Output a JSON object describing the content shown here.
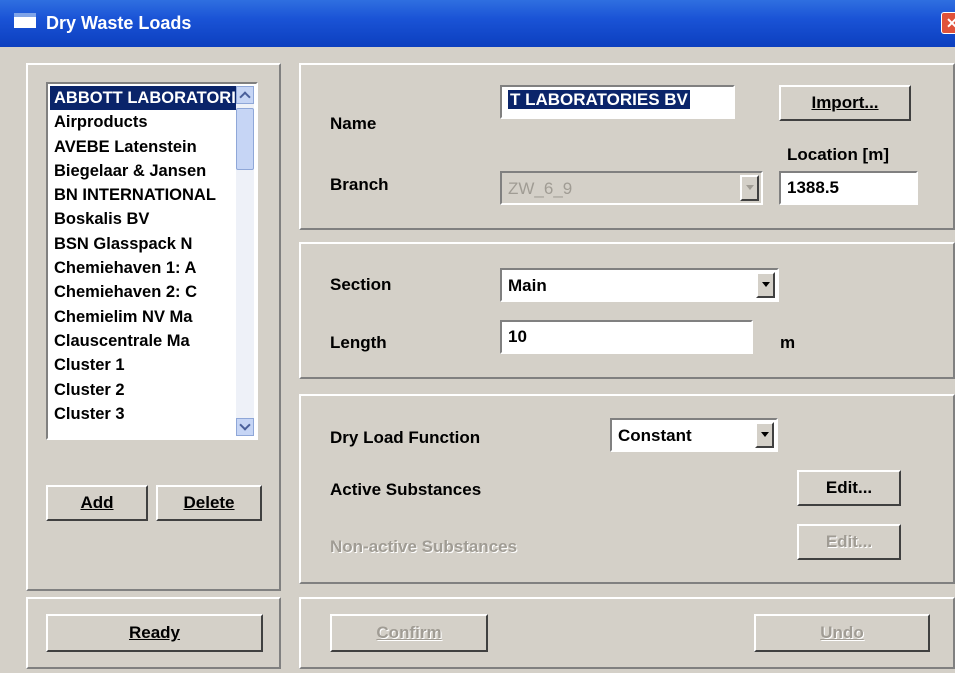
{
  "window": {
    "title": "Dry Waste Loads",
    "icon": "window-icon",
    "close_icon": "close-icon"
  },
  "loads_list": {
    "items": [
      "ABBOTT LABORATORIES BV",
      "Airproducts",
      "AVEBE Latenstein",
      "Biegelaar & Jansen",
      "BN INTERNATIONAL",
      "Boskalis BV",
      "BSN Glasspack N",
      "Chemiehaven 1: A",
      "Chemiehaven 2: C",
      "Chemielim NV Ma",
      "Clauscentrale Ma",
      "Cluster 1",
      "Cluster 2",
      "Cluster 3"
    ],
    "selected_index": 0
  },
  "buttons": {
    "add": "Add",
    "delete": "Delete",
    "ready": "Ready",
    "import": "Import...",
    "edit_active": "Edit...",
    "edit_nonactive": "Edit...",
    "confirm": "Confirm",
    "undo": "Undo"
  },
  "identity": {
    "name_label": "Name",
    "name_value": "T LABORATORIES BV",
    "branch_label": "Branch",
    "branch_value": "ZW_6_9",
    "location_label": "Location [m]",
    "location_value": "1388.5"
  },
  "section": {
    "section_label": "Section",
    "section_value": "Main",
    "length_label": "Length",
    "length_value": "10",
    "length_unit": "m"
  },
  "loads": {
    "function_label": "Dry Load Function",
    "function_value": "Constant",
    "active_label": "Active Substances",
    "nonactive_label": "Non-active Substances"
  },
  "colors": {
    "selection": "#0a246a",
    "face": "#d4d0c8",
    "titlebar": "#1a53d6"
  }
}
